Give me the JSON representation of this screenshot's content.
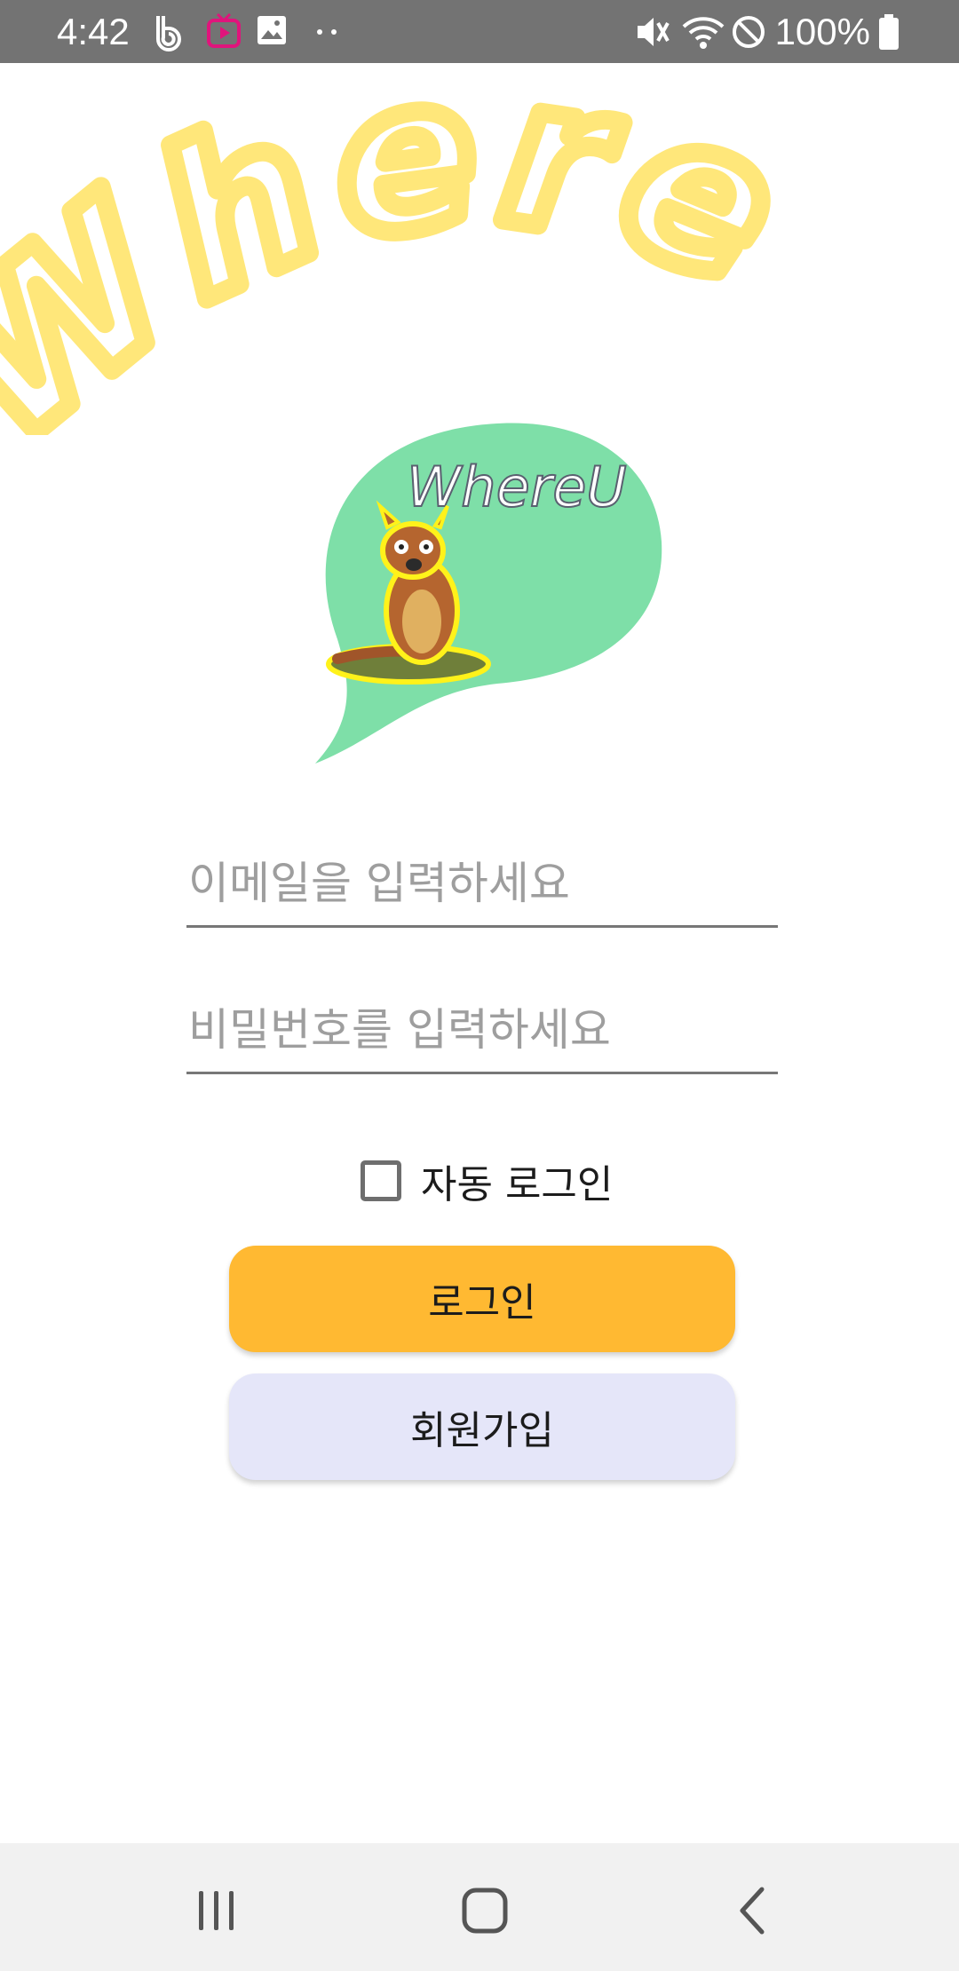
{
  "status_bar": {
    "time": "4:42",
    "battery": "100%",
    "icons": [
      "b-app-icon",
      "tv-app-icon",
      "gallery-icon",
      "more-dots-icon",
      "mute-icon",
      "wifi-icon",
      "do-not-disturb-icon",
      "battery-icon"
    ],
    "tv_icon_color": "#e0147c"
  },
  "header": {
    "title": "Where U",
    "title_color": "#ffe77a"
  },
  "logo": {
    "text": "WhereU",
    "bubble_color": "#7edfa8",
    "mascot": "kangaroo-icon"
  },
  "form": {
    "email_placeholder": "이메일을 입력하세요",
    "email_value": "",
    "password_placeholder": "비밀번호를 입력하세요",
    "password_value": "",
    "auto_login_label": "자동 로그인",
    "auto_login_checked": false
  },
  "buttons": {
    "login_label": "로그인",
    "login_color": "#ffb932",
    "signup_label": "회원가입",
    "signup_color": "#e5e6f9"
  },
  "nav_bar": {
    "items": [
      "recent-apps-icon",
      "home-icon",
      "back-icon"
    ]
  }
}
